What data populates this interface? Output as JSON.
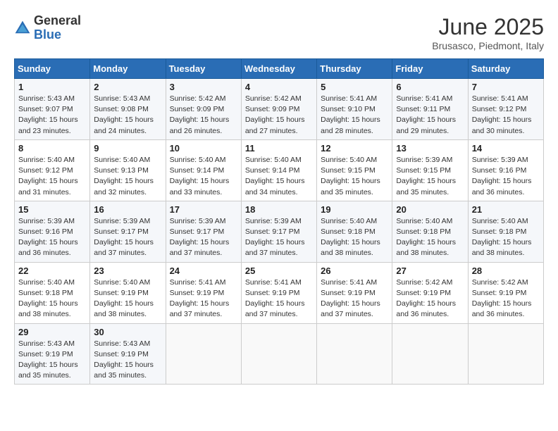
{
  "logo": {
    "general": "General",
    "blue": "Blue"
  },
  "title": "June 2025",
  "subtitle": "Brusasco, Piedmont, Italy",
  "headers": [
    "Sunday",
    "Monday",
    "Tuesday",
    "Wednesday",
    "Thursday",
    "Friday",
    "Saturday"
  ],
  "weeks": [
    [
      {
        "day": "1",
        "info": "Sunrise: 5:43 AM\nSunset: 9:07 PM\nDaylight: 15 hours\nand 23 minutes."
      },
      {
        "day": "2",
        "info": "Sunrise: 5:43 AM\nSunset: 9:08 PM\nDaylight: 15 hours\nand 24 minutes."
      },
      {
        "day": "3",
        "info": "Sunrise: 5:42 AM\nSunset: 9:09 PM\nDaylight: 15 hours\nand 26 minutes."
      },
      {
        "day": "4",
        "info": "Sunrise: 5:42 AM\nSunset: 9:09 PM\nDaylight: 15 hours\nand 27 minutes."
      },
      {
        "day": "5",
        "info": "Sunrise: 5:41 AM\nSunset: 9:10 PM\nDaylight: 15 hours\nand 28 minutes."
      },
      {
        "day": "6",
        "info": "Sunrise: 5:41 AM\nSunset: 9:11 PM\nDaylight: 15 hours\nand 29 minutes."
      },
      {
        "day": "7",
        "info": "Sunrise: 5:41 AM\nSunset: 9:12 PM\nDaylight: 15 hours\nand 30 minutes."
      }
    ],
    [
      {
        "day": "8",
        "info": "Sunrise: 5:40 AM\nSunset: 9:12 PM\nDaylight: 15 hours\nand 31 minutes."
      },
      {
        "day": "9",
        "info": "Sunrise: 5:40 AM\nSunset: 9:13 PM\nDaylight: 15 hours\nand 32 minutes."
      },
      {
        "day": "10",
        "info": "Sunrise: 5:40 AM\nSunset: 9:14 PM\nDaylight: 15 hours\nand 33 minutes."
      },
      {
        "day": "11",
        "info": "Sunrise: 5:40 AM\nSunset: 9:14 PM\nDaylight: 15 hours\nand 34 minutes."
      },
      {
        "day": "12",
        "info": "Sunrise: 5:40 AM\nSunset: 9:15 PM\nDaylight: 15 hours\nand 35 minutes."
      },
      {
        "day": "13",
        "info": "Sunrise: 5:39 AM\nSunset: 9:15 PM\nDaylight: 15 hours\nand 35 minutes."
      },
      {
        "day": "14",
        "info": "Sunrise: 5:39 AM\nSunset: 9:16 PM\nDaylight: 15 hours\nand 36 minutes."
      }
    ],
    [
      {
        "day": "15",
        "info": "Sunrise: 5:39 AM\nSunset: 9:16 PM\nDaylight: 15 hours\nand 36 minutes."
      },
      {
        "day": "16",
        "info": "Sunrise: 5:39 AM\nSunset: 9:17 PM\nDaylight: 15 hours\nand 37 minutes."
      },
      {
        "day": "17",
        "info": "Sunrise: 5:39 AM\nSunset: 9:17 PM\nDaylight: 15 hours\nand 37 minutes."
      },
      {
        "day": "18",
        "info": "Sunrise: 5:39 AM\nSunset: 9:17 PM\nDaylight: 15 hours\nand 37 minutes."
      },
      {
        "day": "19",
        "info": "Sunrise: 5:40 AM\nSunset: 9:18 PM\nDaylight: 15 hours\nand 38 minutes."
      },
      {
        "day": "20",
        "info": "Sunrise: 5:40 AM\nSunset: 9:18 PM\nDaylight: 15 hours\nand 38 minutes."
      },
      {
        "day": "21",
        "info": "Sunrise: 5:40 AM\nSunset: 9:18 PM\nDaylight: 15 hours\nand 38 minutes."
      }
    ],
    [
      {
        "day": "22",
        "info": "Sunrise: 5:40 AM\nSunset: 9:18 PM\nDaylight: 15 hours\nand 38 minutes."
      },
      {
        "day": "23",
        "info": "Sunrise: 5:40 AM\nSunset: 9:19 PM\nDaylight: 15 hours\nand 38 minutes."
      },
      {
        "day": "24",
        "info": "Sunrise: 5:41 AM\nSunset: 9:19 PM\nDaylight: 15 hours\nand 37 minutes."
      },
      {
        "day": "25",
        "info": "Sunrise: 5:41 AM\nSunset: 9:19 PM\nDaylight: 15 hours\nand 37 minutes."
      },
      {
        "day": "26",
        "info": "Sunrise: 5:41 AM\nSunset: 9:19 PM\nDaylight: 15 hours\nand 37 minutes."
      },
      {
        "day": "27",
        "info": "Sunrise: 5:42 AM\nSunset: 9:19 PM\nDaylight: 15 hours\nand 36 minutes."
      },
      {
        "day": "28",
        "info": "Sunrise: 5:42 AM\nSunset: 9:19 PM\nDaylight: 15 hours\nand 36 minutes."
      }
    ],
    [
      {
        "day": "29",
        "info": "Sunrise: 5:43 AM\nSunset: 9:19 PM\nDaylight: 15 hours\nand 35 minutes."
      },
      {
        "day": "30",
        "info": "Sunrise: 5:43 AM\nSunset: 9:19 PM\nDaylight: 15 hours\nand 35 minutes."
      },
      {
        "day": "",
        "info": ""
      },
      {
        "day": "",
        "info": ""
      },
      {
        "day": "",
        "info": ""
      },
      {
        "day": "",
        "info": ""
      },
      {
        "day": "",
        "info": ""
      }
    ]
  ]
}
